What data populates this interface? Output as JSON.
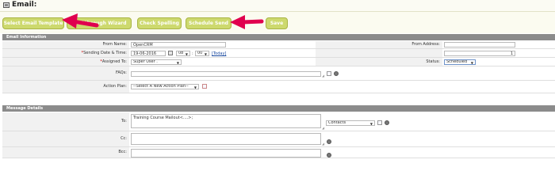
{
  "window": {
    "title": "Email:"
  },
  "toolbar": {
    "buttons": [
      {
        "label": "Select Email Template"
      },
      {
        "label": "Walkthrough Wizard"
      },
      {
        "label": "Check Spelling"
      },
      {
        "label": "Schedule Send"
      },
      {
        "label": "Save"
      }
    ]
  },
  "email_info": {
    "header": "Email Information",
    "from_name": {
      "label": "From Name:",
      "value": "OpenCRM"
    },
    "from_address": {
      "label": "From Address:",
      "value": ""
    },
    "sending": {
      "label": "Sending Date & Time:",
      "required_mark": "*",
      "date": "19-06-2016",
      "hour": "08",
      "sep": ":",
      "minute": "00",
      "today_link": "[Today]"
    },
    "unnamed_field": {
      "value": "1"
    },
    "assigned": {
      "label": "Assigned To:",
      "required_mark": "*",
      "value": "Super User ."
    },
    "status": {
      "label": "Status:",
      "value": "Scheduled"
    },
    "faqs": {
      "label": "FAQs:",
      "value": ""
    },
    "action_plan": {
      "label": "Action Plan:",
      "value": "--Select A New Action Plan--"
    }
  },
  "message": {
    "header": "Message Details",
    "to": {
      "label": "To:",
      "value": "Training Course Mailout<....>;",
      "contacts_select": "Contacts"
    },
    "cc": {
      "label": "Cc:",
      "value": ""
    },
    "bcc": {
      "label": "Bcc:",
      "value": ""
    }
  },
  "colors": {
    "button_bg": "#cdd96e",
    "section_header": "#8b8b8b",
    "annotation_arrow": "#e0004e",
    "label_bg": "#f1f1f1"
  }
}
